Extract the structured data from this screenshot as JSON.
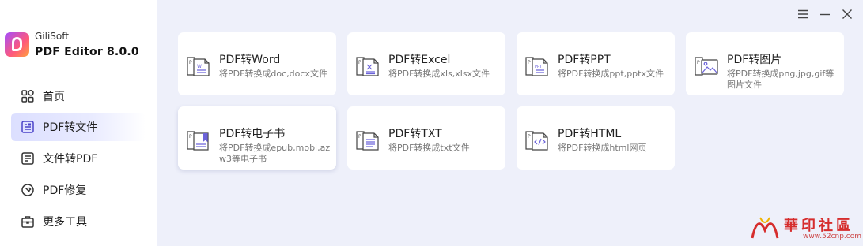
{
  "app": {
    "brand": "GiliSoft",
    "name": "PDF Editor 8.0.0"
  },
  "sidebar": {
    "items": [
      {
        "label": "首页",
        "icon": "home-grid-icon",
        "active": false
      },
      {
        "label": "PDF转文件",
        "icon": "pdf-convert-icon",
        "active": true
      },
      {
        "label": "文件转PDF",
        "icon": "file-to-pdf-icon",
        "active": false
      },
      {
        "label": "PDF修复",
        "icon": "repair-icon",
        "active": false
      },
      {
        "label": "更多工具",
        "icon": "toolbox-icon",
        "active": false
      }
    ]
  },
  "window_controls": [
    "menu-icon",
    "minimize-icon",
    "close-icon"
  ],
  "cards": [
    {
      "title": "PDF转Word",
      "desc": "将PDF转换成doc,docx文件",
      "icon": "pdf-to-word-icon",
      "accent": "#6c63d9"
    },
    {
      "title": "PDF转Excel",
      "desc": "将PDF转换成xls,xlsx文件",
      "icon": "pdf-to-excel-icon",
      "accent": "#6c63d9"
    },
    {
      "title": "PDF转PPT",
      "desc": "将PDF转换成ppt,pptx文件",
      "icon": "pdf-to-ppt-icon",
      "accent": "#6c63d9"
    },
    {
      "title": "PDF转图片",
      "desc": "将PDF转换成png,jpg,gif等图片文件",
      "icon": "pdf-to-image-icon",
      "accent": "#6c63d9"
    },
    {
      "title": "PDF转电子书",
      "desc": "将PDF转换成epub,mobi,azw3等电子书",
      "icon": "pdf-to-ebook-icon",
      "accent": "#6c63d9"
    },
    {
      "title": "PDF转TXT",
      "desc": "将PDF转换成txt文件",
      "icon": "pdf-to-txt-icon",
      "accent": "#6c63d9"
    },
    {
      "title": "PDF转HTML",
      "desc": "将PDF转换成html网页",
      "icon": "pdf-to-html-icon",
      "accent": "#6c63d9"
    }
  ],
  "watermark": {
    "text": "華印社區",
    "url": "www.52cnp.com"
  },
  "colors": {
    "accent": "#6c63d9",
    "active_nav": "#dcdfff",
    "background": "#eef0fa"
  }
}
